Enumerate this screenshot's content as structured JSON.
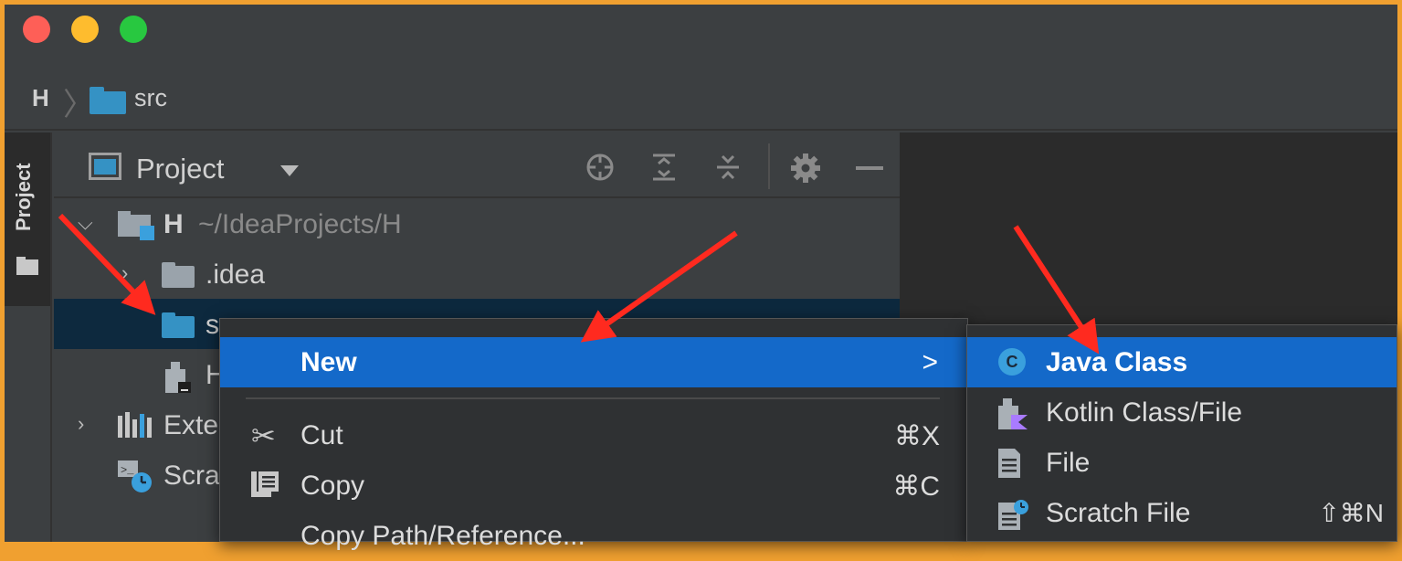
{
  "breadcrumb": {
    "root": "H",
    "folder": "src"
  },
  "stripe": {
    "label": "Project"
  },
  "panel": {
    "title": "Project",
    "tree": [
      {
        "name": "H",
        "path": "~/IdeaProjects/H"
      },
      {
        "name": ".idea"
      },
      {
        "name": "src"
      },
      {
        "name": "H"
      },
      {
        "name": "Exte"
      },
      {
        "name": "Scra"
      }
    ]
  },
  "context_menu": {
    "new_label": "New",
    "new_arrow": ">",
    "items": [
      {
        "label": "Cut",
        "shortcut": "⌘X",
        "icon": "scissors-icon"
      },
      {
        "label": "Copy",
        "shortcut": "⌘C",
        "icon": "copy-icon"
      },
      {
        "label": "Copy Path/Reference..."
      }
    ]
  },
  "submenu": {
    "items": [
      {
        "label": "Java Class",
        "icon": "java-class-icon",
        "icon_text": "C"
      },
      {
        "label": "Kotlin Class/File",
        "icon": "kotlin-file-icon"
      },
      {
        "label": "File",
        "icon": "file-icon"
      },
      {
        "label": "Scratch File",
        "shortcut": "⇧⌘N",
        "icon": "scratch-file-icon"
      }
    ]
  },
  "colors": {
    "selection": "#1469c9",
    "tree_selection": "#0d293e",
    "annotation_arrow": "#ff2a1f",
    "folder_blue": "#3592c4"
  }
}
